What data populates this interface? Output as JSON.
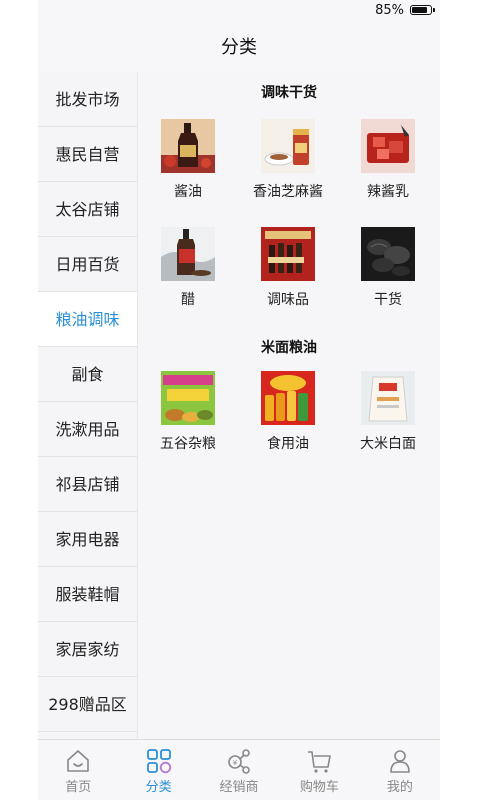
{
  "status_bar": {
    "battery": "85%"
  },
  "header": {
    "title": "分类"
  },
  "sidebar": {
    "items": [
      {
        "label": "批发市场"
      },
      {
        "label": "惠民自营"
      },
      {
        "label": "太谷店铺"
      },
      {
        "label": "日用百货"
      },
      {
        "label": "粮油调味",
        "active": true
      },
      {
        "label": "副食"
      },
      {
        "label": "洗漱用品"
      },
      {
        "label": "祁县店铺"
      },
      {
        "label": "家用电器"
      },
      {
        "label": "服装鞋帽"
      },
      {
        "label": "家居家纺"
      },
      {
        "label": "298赠品区"
      }
    ]
  },
  "main": {
    "sections": [
      {
        "title": "调味干货",
        "items": [
          {
            "label": "酱油",
            "icon": "soy-sauce-thumb"
          },
          {
            "label": "香油芝麻酱",
            "icon": "sesame-paste-thumb"
          },
          {
            "label": "辣酱乳",
            "icon": "chili-sauce-thumb"
          },
          {
            "label": "醋",
            "icon": "vinegar-thumb"
          },
          {
            "label": "调味品",
            "icon": "seasoning-thumb"
          },
          {
            "label": "干货",
            "icon": "dried-goods-thumb"
          }
        ]
      },
      {
        "title": "米面粮油",
        "items": [
          {
            "label": "五谷杂粮",
            "icon": "grains-thumb"
          },
          {
            "label": "食用油",
            "icon": "cooking-oil-thumb"
          },
          {
            "label": "大米白面",
            "icon": "rice-flour-thumb"
          }
        ]
      }
    ]
  },
  "tab_bar": {
    "tabs": [
      {
        "label": "首页",
        "icon": "home-icon"
      },
      {
        "label": "分类",
        "icon": "category-icon",
        "active": true
      },
      {
        "label": "经销商",
        "icon": "distributor-icon"
      },
      {
        "label": "购物车",
        "icon": "cart-icon"
      },
      {
        "label": "我的",
        "icon": "profile-icon"
      }
    ]
  },
  "colors": {
    "accent": "#2a8fd6",
    "inactive": "#888888"
  }
}
